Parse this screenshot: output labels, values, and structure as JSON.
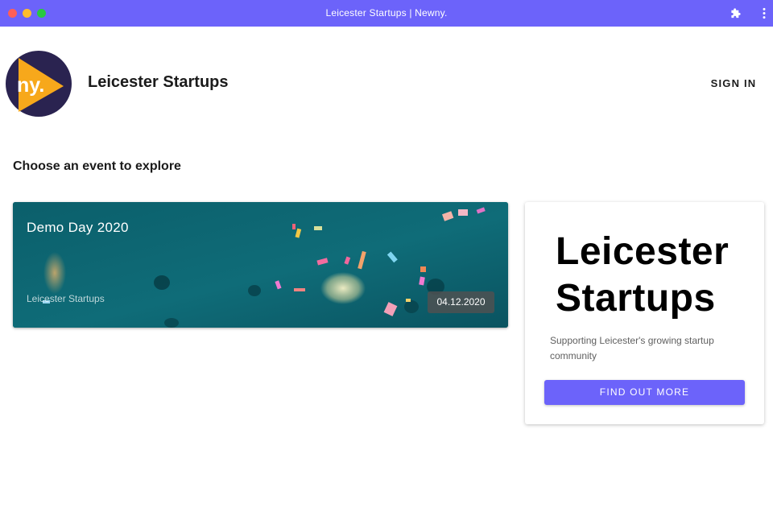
{
  "window": {
    "title": "Leicester Startups | Newny."
  },
  "header": {
    "logo_text": "ny.",
    "org_name": "Leicester Startups",
    "sign_in_label": "SIGN IN"
  },
  "main": {
    "heading": "Choose an event to explore",
    "events": [
      {
        "title": "Demo Day 2020",
        "organizer": "Leicester Startups",
        "date": "04.12.2020"
      }
    ]
  },
  "side_card": {
    "brand_line_1": "Leicester",
    "brand_line_2": "Startups",
    "tagline": "Supporting Leicester's growing startup community",
    "button_label": "FIND OUT MORE"
  },
  "colors": {
    "accent": "#6c63fa",
    "logo_circle": "#2a2350",
    "logo_triangle": "#f7a81b",
    "event_background": "#0d6571"
  },
  "icons": {
    "titlebar_right": [
      "puzzle-icon",
      "more-vertical-icon"
    ]
  }
}
